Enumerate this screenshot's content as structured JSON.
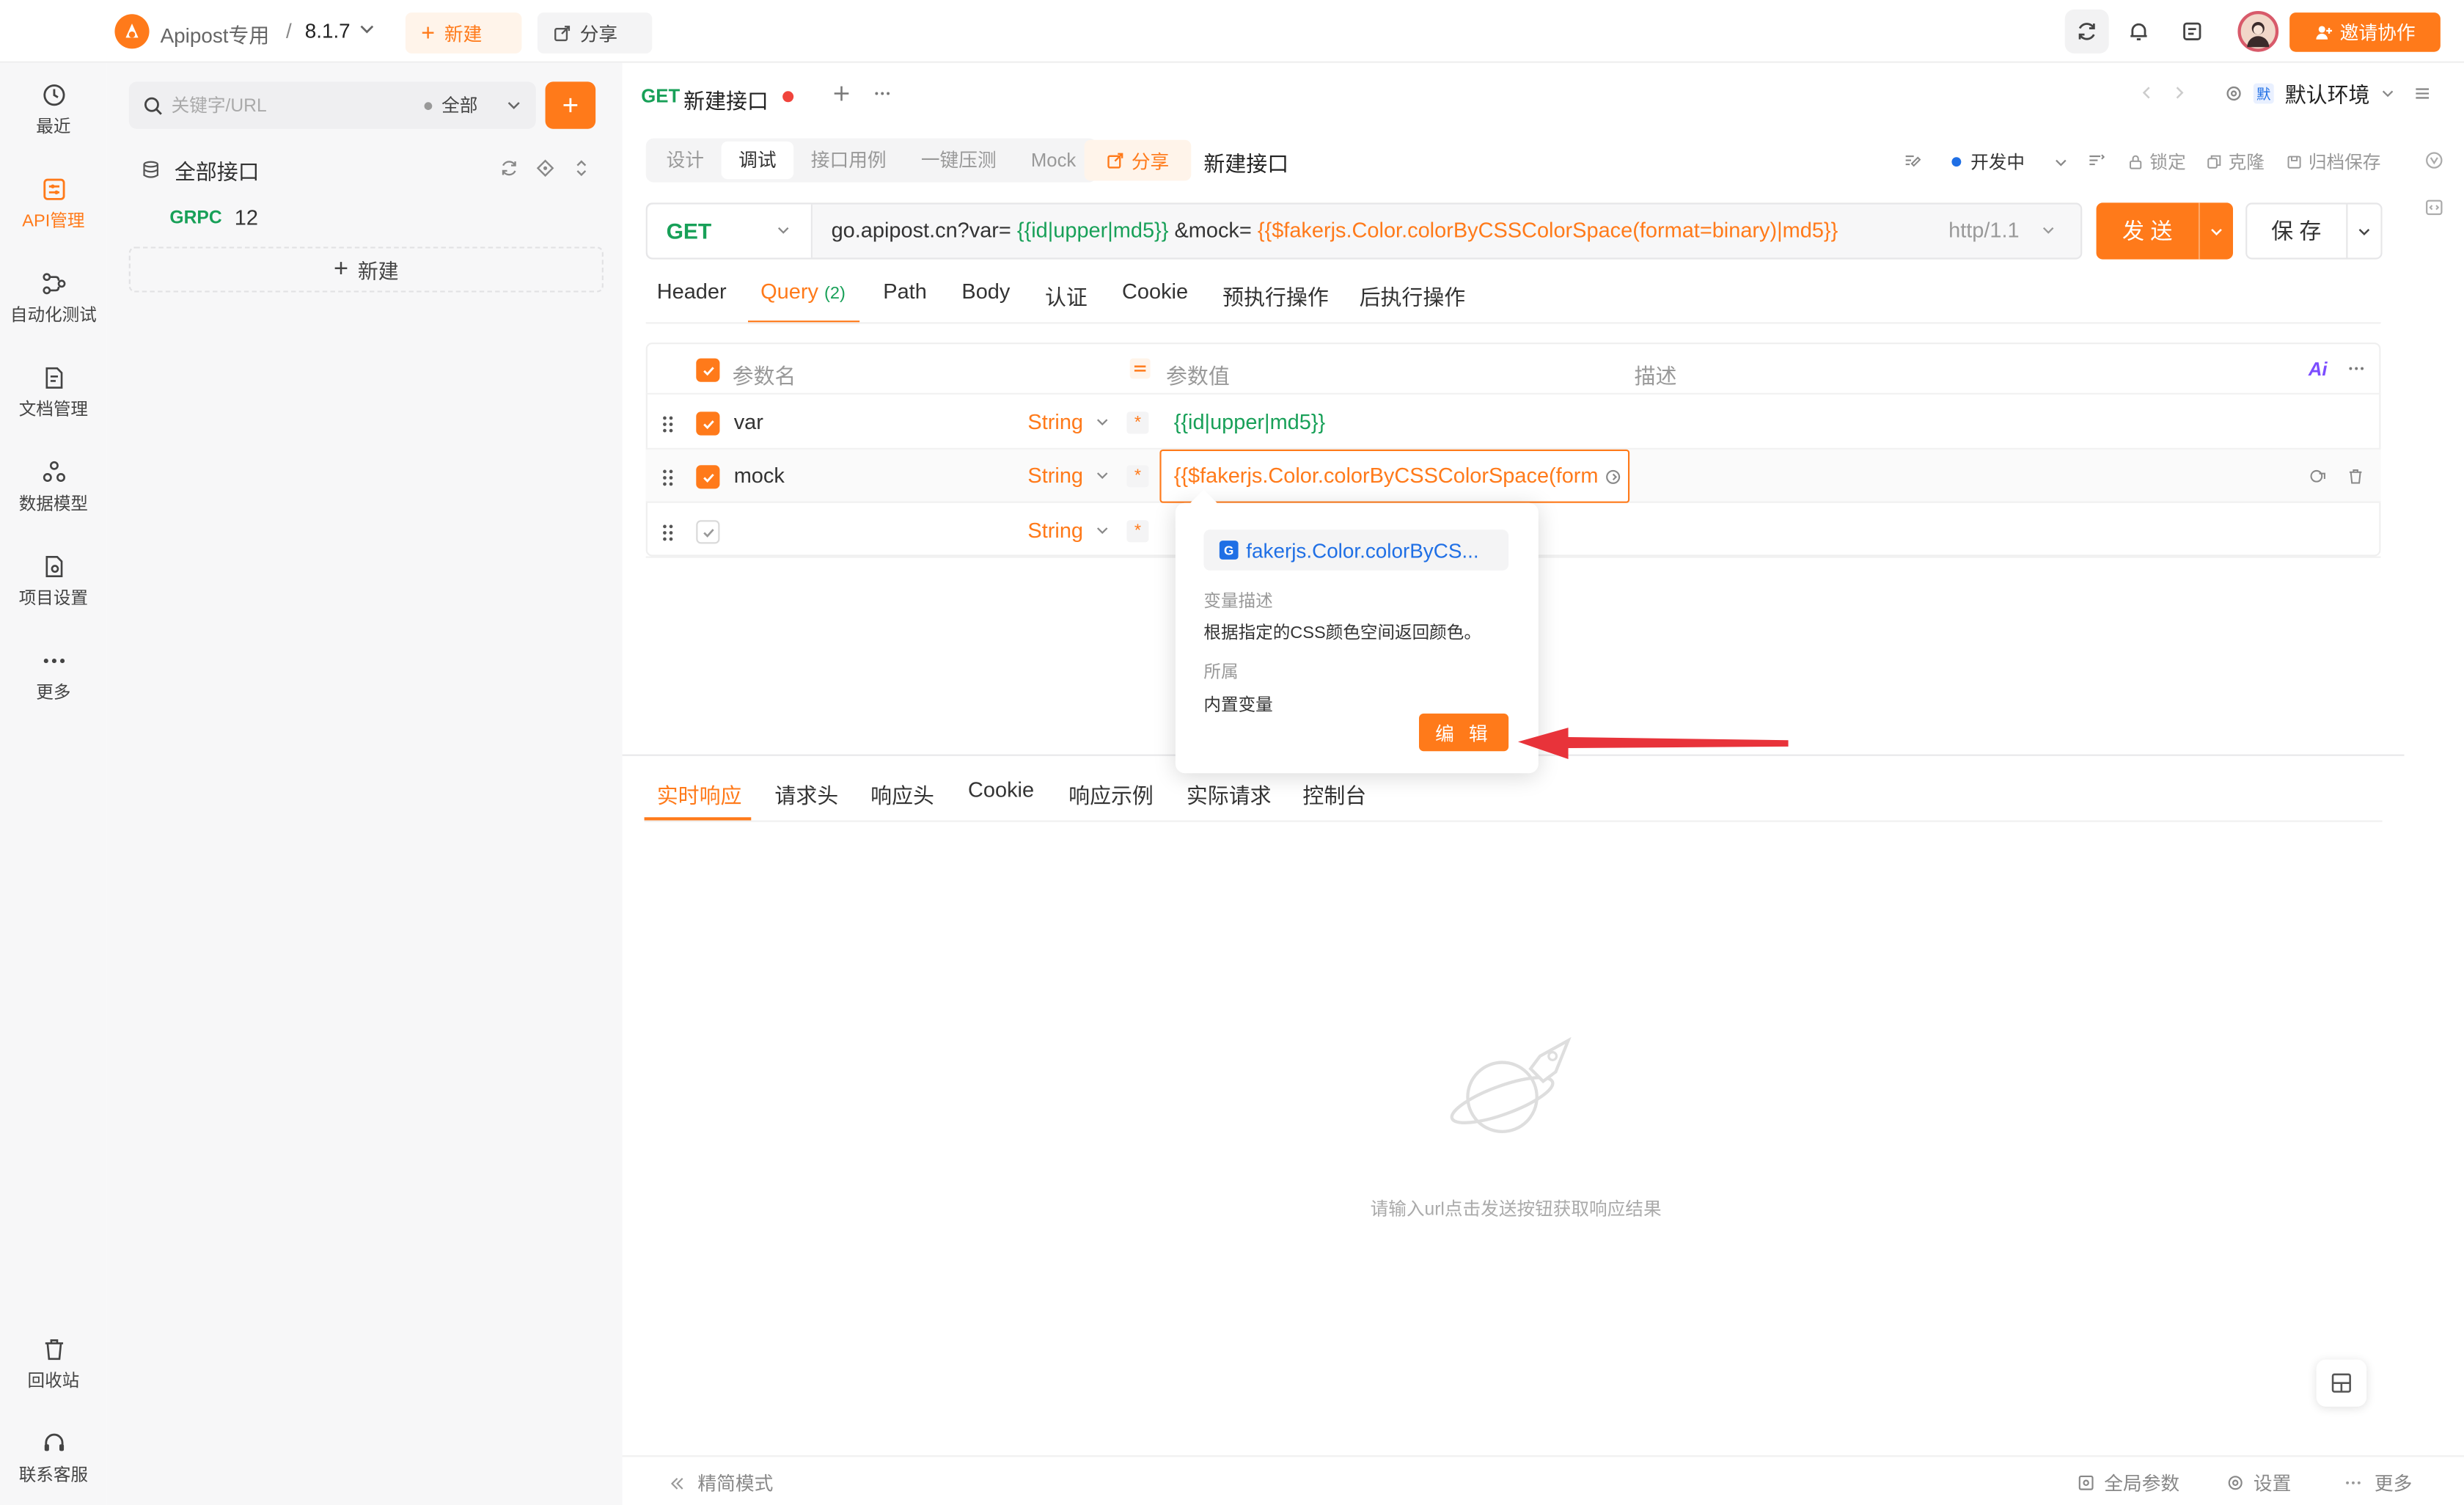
{
  "colors": {
    "accent": "#ff7a1a",
    "get_method": "#18a058",
    "variable": "#18a058",
    "link_blue": "#1f6fe5",
    "arrow_red": "#e8333a"
  },
  "topbar": {
    "project_name": "Apipost专用",
    "separator": "/",
    "version": "8.1.7",
    "new_label": "新建",
    "share_label": "分享",
    "invite_label": "邀请协作"
  },
  "leftnav": {
    "items": [
      {
        "label": "最近",
        "icon": "clock-icon"
      },
      {
        "label": "API管理",
        "icon": "api-icon",
        "active": true
      },
      {
        "label": "自动化测试",
        "icon": "flow-icon"
      },
      {
        "label": "文档管理",
        "icon": "doc-icon"
      },
      {
        "label": "数据模型",
        "icon": "model-icon"
      },
      {
        "label": "项目设置",
        "icon": "settings-doc-icon"
      },
      {
        "label": "更多",
        "icon": "more-icon"
      }
    ],
    "bottom": [
      {
        "label": "回收站",
        "icon": "trash-icon"
      },
      {
        "label": "联系客服",
        "icon": "headset-icon"
      }
    ]
  },
  "tree": {
    "search_placeholder": "关键字/URL",
    "filter_label": "全部",
    "root_label": "全部接口",
    "item_method": "GRPC",
    "item_name": "12",
    "new_label": "新建"
  },
  "tab": {
    "method": "GET",
    "title": "新建接口"
  },
  "env": {
    "badge": "默",
    "label": "默认环境"
  },
  "subtabs": [
    "设计",
    "调试",
    "接口用例",
    "一键压测",
    "Mock"
  ],
  "share_label": "分享",
  "api_name": "新建接口",
  "toolbar": {
    "status": "开发中",
    "lock": "锁定",
    "clone": "克隆",
    "archive": "归档保存"
  },
  "request": {
    "method": "GET",
    "url_prefix": "go.apipost.cn?var=",
    "url_var1": "{{id|upper|md5}}",
    "url_mid": "&mock=",
    "url_var2": "{{$fakerjs.Color.colorByCSSColorSpace(format=binary)|md5}}",
    "protocol": "http/1.1",
    "send_label": "发 送",
    "save_label": "保 存"
  },
  "req_tabs": [
    "Header",
    "Query",
    "Path",
    "Body",
    "认证",
    "Cookie",
    "预执行操作",
    "后执行操作"
  ],
  "query_count": "(2)",
  "params": {
    "header_name": "参数名",
    "header_value": "参数值",
    "header_desc": "描述",
    "rows": [
      {
        "name": "var",
        "type": "String",
        "value": "{{id|upper|md5}}"
      },
      {
        "name": "mock",
        "type": "String",
        "value": "{{$fakerjs.Color.colorByCSSColorSpace(form"
      },
      {
        "name": "",
        "type": "String",
        "value": ""
      }
    ]
  },
  "popover": {
    "var_badge": "G",
    "var_name": "fakerjs.Color.colorByCS...",
    "desc_label": "变量描述",
    "desc_text": "根据指定的CSS颜色空间返回颜色。",
    "owner_label": "所属",
    "owner_text": "内置变量",
    "edit_label": "编 辑"
  },
  "resp_tabs": [
    "实时响应",
    "请求头",
    "响应头",
    "Cookie",
    "响应示例",
    "实际请求",
    "控制台"
  ],
  "empty_hint": "请输入url点击发送按钮获取响应结果",
  "bottombar": {
    "simple_mode": "精简模式",
    "global_params": "全局参数",
    "settings": "设置",
    "more": "更多"
  }
}
